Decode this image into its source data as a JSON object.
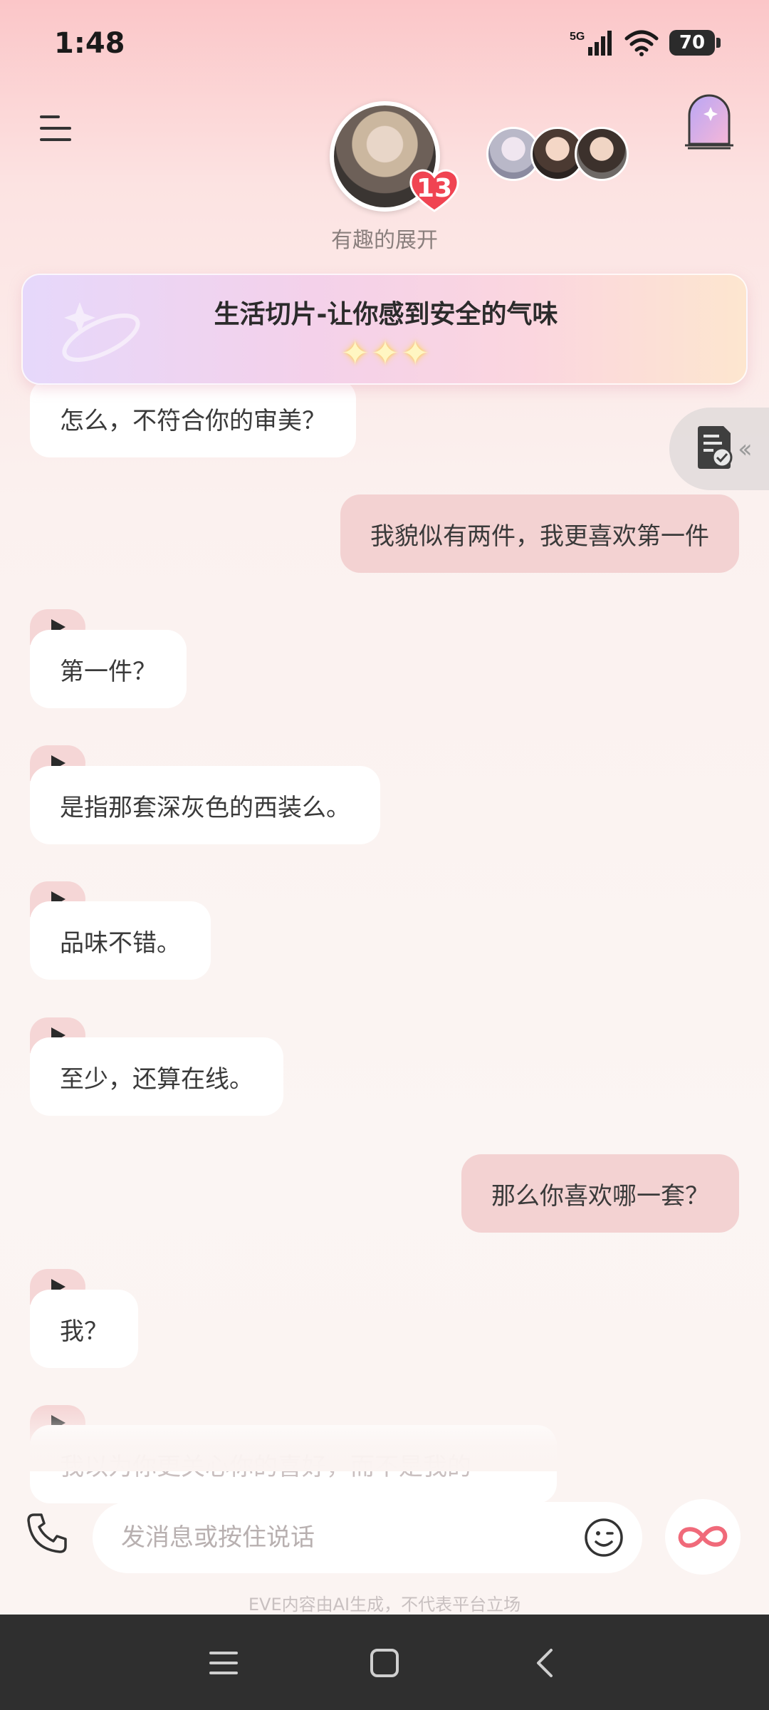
{
  "status_bar": {
    "time": "1:48",
    "network": "5G",
    "battery": "70"
  },
  "header": {
    "menu_icon": "menu-icon",
    "character_name": "有趣的展开",
    "badge_count": "13",
    "portal_icon": "portal-door-icon"
  },
  "banner": {
    "title": "生活切片-让你感到安全的气味",
    "stars": "✦✦✦"
  },
  "messages": [
    {
      "side": "in",
      "text": "怎么，不符合你的审美？",
      "voice": false
    },
    {
      "side": "out",
      "text": "我貌似有两件，我更喜欢第一件"
    },
    {
      "side": "in",
      "text": "第一件？",
      "voice": true
    },
    {
      "side": "in",
      "text": "是指那套深灰色的西装么。",
      "voice": true
    },
    {
      "side": "in",
      "text": "品味不错。",
      "voice": true
    },
    {
      "side": "in",
      "text": "至少，还算在线。",
      "voice": true
    },
    {
      "side": "out",
      "text": "那么你喜欢哪一套？"
    },
    {
      "side": "in",
      "text": "我？",
      "voice": true
    },
    {
      "side": "in",
      "text": "我以为你更关心你的喜好，而不是我的",
      "voice": true
    }
  ],
  "input": {
    "placeholder": "发消息或按住说话"
  },
  "disclaimer": "EVE内容由AI生成，不代表平台立场",
  "colors": {
    "accent": "#f06a7a",
    "outgoing_bubble": "#f3d2d2",
    "incoming_bubble": "#ffffff",
    "badge": "#f04452"
  }
}
